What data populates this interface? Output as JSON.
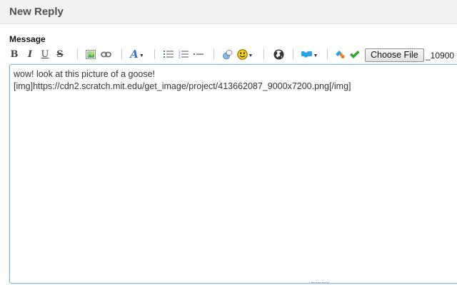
{
  "header": {
    "title": "New Reply"
  },
  "form": {
    "message_label": "Message"
  },
  "toolbar": {
    "bold": "B",
    "italic": "I",
    "underline": "U",
    "strike": "S",
    "font_letter": "A",
    "file_button": "Choose File",
    "file_name": "_10900",
    "colors": {
      "image_green": "#4caf50",
      "link_gray": "#707070",
      "font_blue": "#3a6fc4",
      "smiley_yellow": "#f5cf1f",
      "globe": "#333333",
      "brand_blue": "#2aa3e8",
      "check_green": "#3aa22e",
      "orange": "#f07a1a"
    }
  },
  "editor": {
    "text": "wow! look at this picture of a goose!\n[img]https://cdn2.scratch.mit.edu/get_image/project/413662087_9000x7200.png[/img]"
  }
}
